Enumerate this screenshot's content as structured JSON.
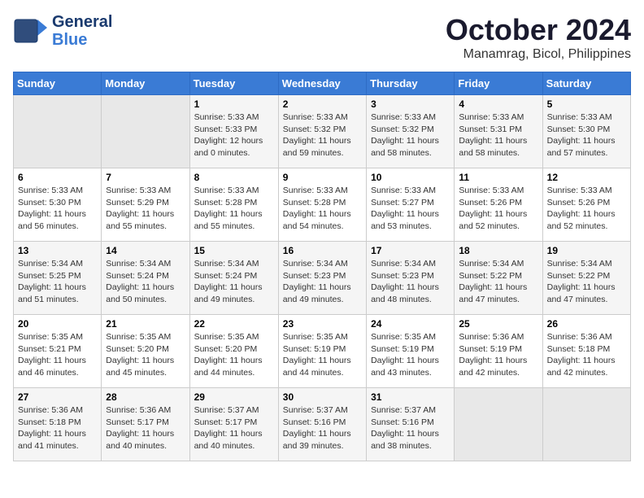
{
  "header": {
    "logo_line1": "General",
    "logo_line2": "Blue",
    "month": "October 2024",
    "location": "Manamrag, Bicol, Philippines"
  },
  "weekdays": [
    "Sunday",
    "Monday",
    "Tuesday",
    "Wednesday",
    "Thursday",
    "Friday",
    "Saturday"
  ],
  "weeks": [
    [
      {
        "day": "",
        "info": ""
      },
      {
        "day": "",
        "info": ""
      },
      {
        "day": "1",
        "info": "Sunrise: 5:33 AM\nSunset: 5:33 PM\nDaylight: 12 hours\nand 0 minutes."
      },
      {
        "day": "2",
        "info": "Sunrise: 5:33 AM\nSunset: 5:32 PM\nDaylight: 11 hours\nand 59 minutes."
      },
      {
        "day": "3",
        "info": "Sunrise: 5:33 AM\nSunset: 5:32 PM\nDaylight: 11 hours\nand 58 minutes."
      },
      {
        "day": "4",
        "info": "Sunrise: 5:33 AM\nSunset: 5:31 PM\nDaylight: 11 hours\nand 58 minutes."
      },
      {
        "day": "5",
        "info": "Sunrise: 5:33 AM\nSunset: 5:30 PM\nDaylight: 11 hours\nand 57 minutes."
      }
    ],
    [
      {
        "day": "6",
        "info": "Sunrise: 5:33 AM\nSunset: 5:30 PM\nDaylight: 11 hours\nand 56 minutes."
      },
      {
        "day": "7",
        "info": "Sunrise: 5:33 AM\nSunset: 5:29 PM\nDaylight: 11 hours\nand 55 minutes."
      },
      {
        "day": "8",
        "info": "Sunrise: 5:33 AM\nSunset: 5:28 PM\nDaylight: 11 hours\nand 55 minutes."
      },
      {
        "day": "9",
        "info": "Sunrise: 5:33 AM\nSunset: 5:28 PM\nDaylight: 11 hours\nand 54 minutes."
      },
      {
        "day": "10",
        "info": "Sunrise: 5:33 AM\nSunset: 5:27 PM\nDaylight: 11 hours\nand 53 minutes."
      },
      {
        "day": "11",
        "info": "Sunrise: 5:33 AM\nSunset: 5:26 PM\nDaylight: 11 hours\nand 52 minutes."
      },
      {
        "day": "12",
        "info": "Sunrise: 5:33 AM\nSunset: 5:26 PM\nDaylight: 11 hours\nand 52 minutes."
      }
    ],
    [
      {
        "day": "13",
        "info": "Sunrise: 5:34 AM\nSunset: 5:25 PM\nDaylight: 11 hours\nand 51 minutes."
      },
      {
        "day": "14",
        "info": "Sunrise: 5:34 AM\nSunset: 5:24 PM\nDaylight: 11 hours\nand 50 minutes."
      },
      {
        "day": "15",
        "info": "Sunrise: 5:34 AM\nSunset: 5:24 PM\nDaylight: 11 hours\nand 49 minutes."
      },
      {
        "day": "16",
        "info": "Sunrise: 5:34 AM\nSunset: 5:23 PM\nDaylight: 11 hours\nand 49 minutes."
      },
      {
        "day": "17",
        "info": "Sunrise: 5:34 AM\nSunset: 5:23 PM\nDaylight: 11 hours\nand 48 minutes."
      },
      {
        "day": "18",
        "info": "Sunrise: 5:34 AM\nSunset: 5:22 PM\nDaylight: 11 hours\nand 47 minutes."
      },
      {
        "day": "19",
        "info": "Sunrise: 5:34 AM\nSunset: 5:22 PM\nDaylight: 11 hours\nand 47 minutes."
      }
    ],
    [
      {
        "day": "20",
        "info": "Sunrise: 5:35 AM\nSunset: 5:21 PM\nDaylight: 11 hours\nand 46 minutes."
      },
      {
        "day": "21",
        "info": "Sunrise: 5:35 AM\nSunset: 5:20 PM\nDaylight: 11 hours\nand 45 minutes."
      },
      {
        "day": "22",
        "info": "Sunrise: 5:35 AM\nSunset: 5:20 PM\nDaylight: 11 hours\nand 44 minutes."
      },
      {
        "day": "23",
        "info": "Sunrise: 5:35 AM\nSunset: 5:19 PM\nDaylight: 11 hours\nand 44 minutes."
      },
      {
        "day": "24",
        "info": "Sunrise: 5:35 AM\nSunset: 5:19 PM\nDaylight: 11 hours\nand 43 minutes."
      },
      {
        "day": "25",
        "info": "Sunrise: 5:36 AM\nSunset: 5:19 PM\nDaylight: 11 hours\nand 42 minutes."
      },
      {
        "day": "26",
        "info": "Sunrise: 5:36 AM\nSunset: 5:18 PM\nDaylight: 11 hours\nand 42 minutes."
      }
    ],
    [
      {
        "day": "27",
        "info": "Sunrise: 5:36 AM\nSunset: 5:18 PM\nDaylight: 11 hours\nand 41 minutes."
      },
      {
        "day": "28",
        "info": "Sunrise: 5:36 AM\nSunset: 5:17 PM\nDaylight: 11 hours\nand 40 minutes."
      },
      {
        "day": "29",
        "info": "Sunrise: 5:37 AM\nSunset: 5:17 PM\nDaylight: 11 hours\nand 40 minutes."
      },
      {
        "day": "30",
        "info": "Sunrise: 5:37 AM\nSunset: 5:16 PM\nDaylight: 11 hours\nand 39 minutes."
      },
      {
        "day": "31",
        "info": "Sunrise: 5:37 AM\nSunset: 5:16 PM\nDaylight: 11 hours\nand 38 minutes."
      },
      {
        "day": "",
        "info": ""
      },
      {
        "day": "",
        "info": ""
      }
    ]
  ]
}
